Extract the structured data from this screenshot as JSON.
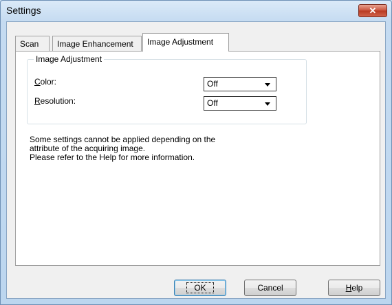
{
  "window": {
    "title": "Settings",
    "close_glyph": "✕"
  },
  "tabs": [
    {
      "label": "Scan"
    },
    {
      "label": "Image Enhancement"
    },
    {
      "label": "Image Adjustment"
    }
  ],
  "group": {
    "title": "Image Adjustment",
    "color_label_mnemonic": "C",
    "color_label_rest": "olor:",
    "color_value": "Off",
    "resolution_label_mnemonic": "R",
    "resolution_label_rest": "esolution:",
    "resolution_value": "Off"
  },
  "info_lines": [
    "Some settings cannot be applied depending on the",
    "attribute of the acquiring image.",
    "Please refer to the Help for more information."
  ],
  "buttons": {
    "ok": "OK",
    "cancel": "Cancel",
    "help_mnemonic": "H",
    "help_rest": "elp"
  }
}
